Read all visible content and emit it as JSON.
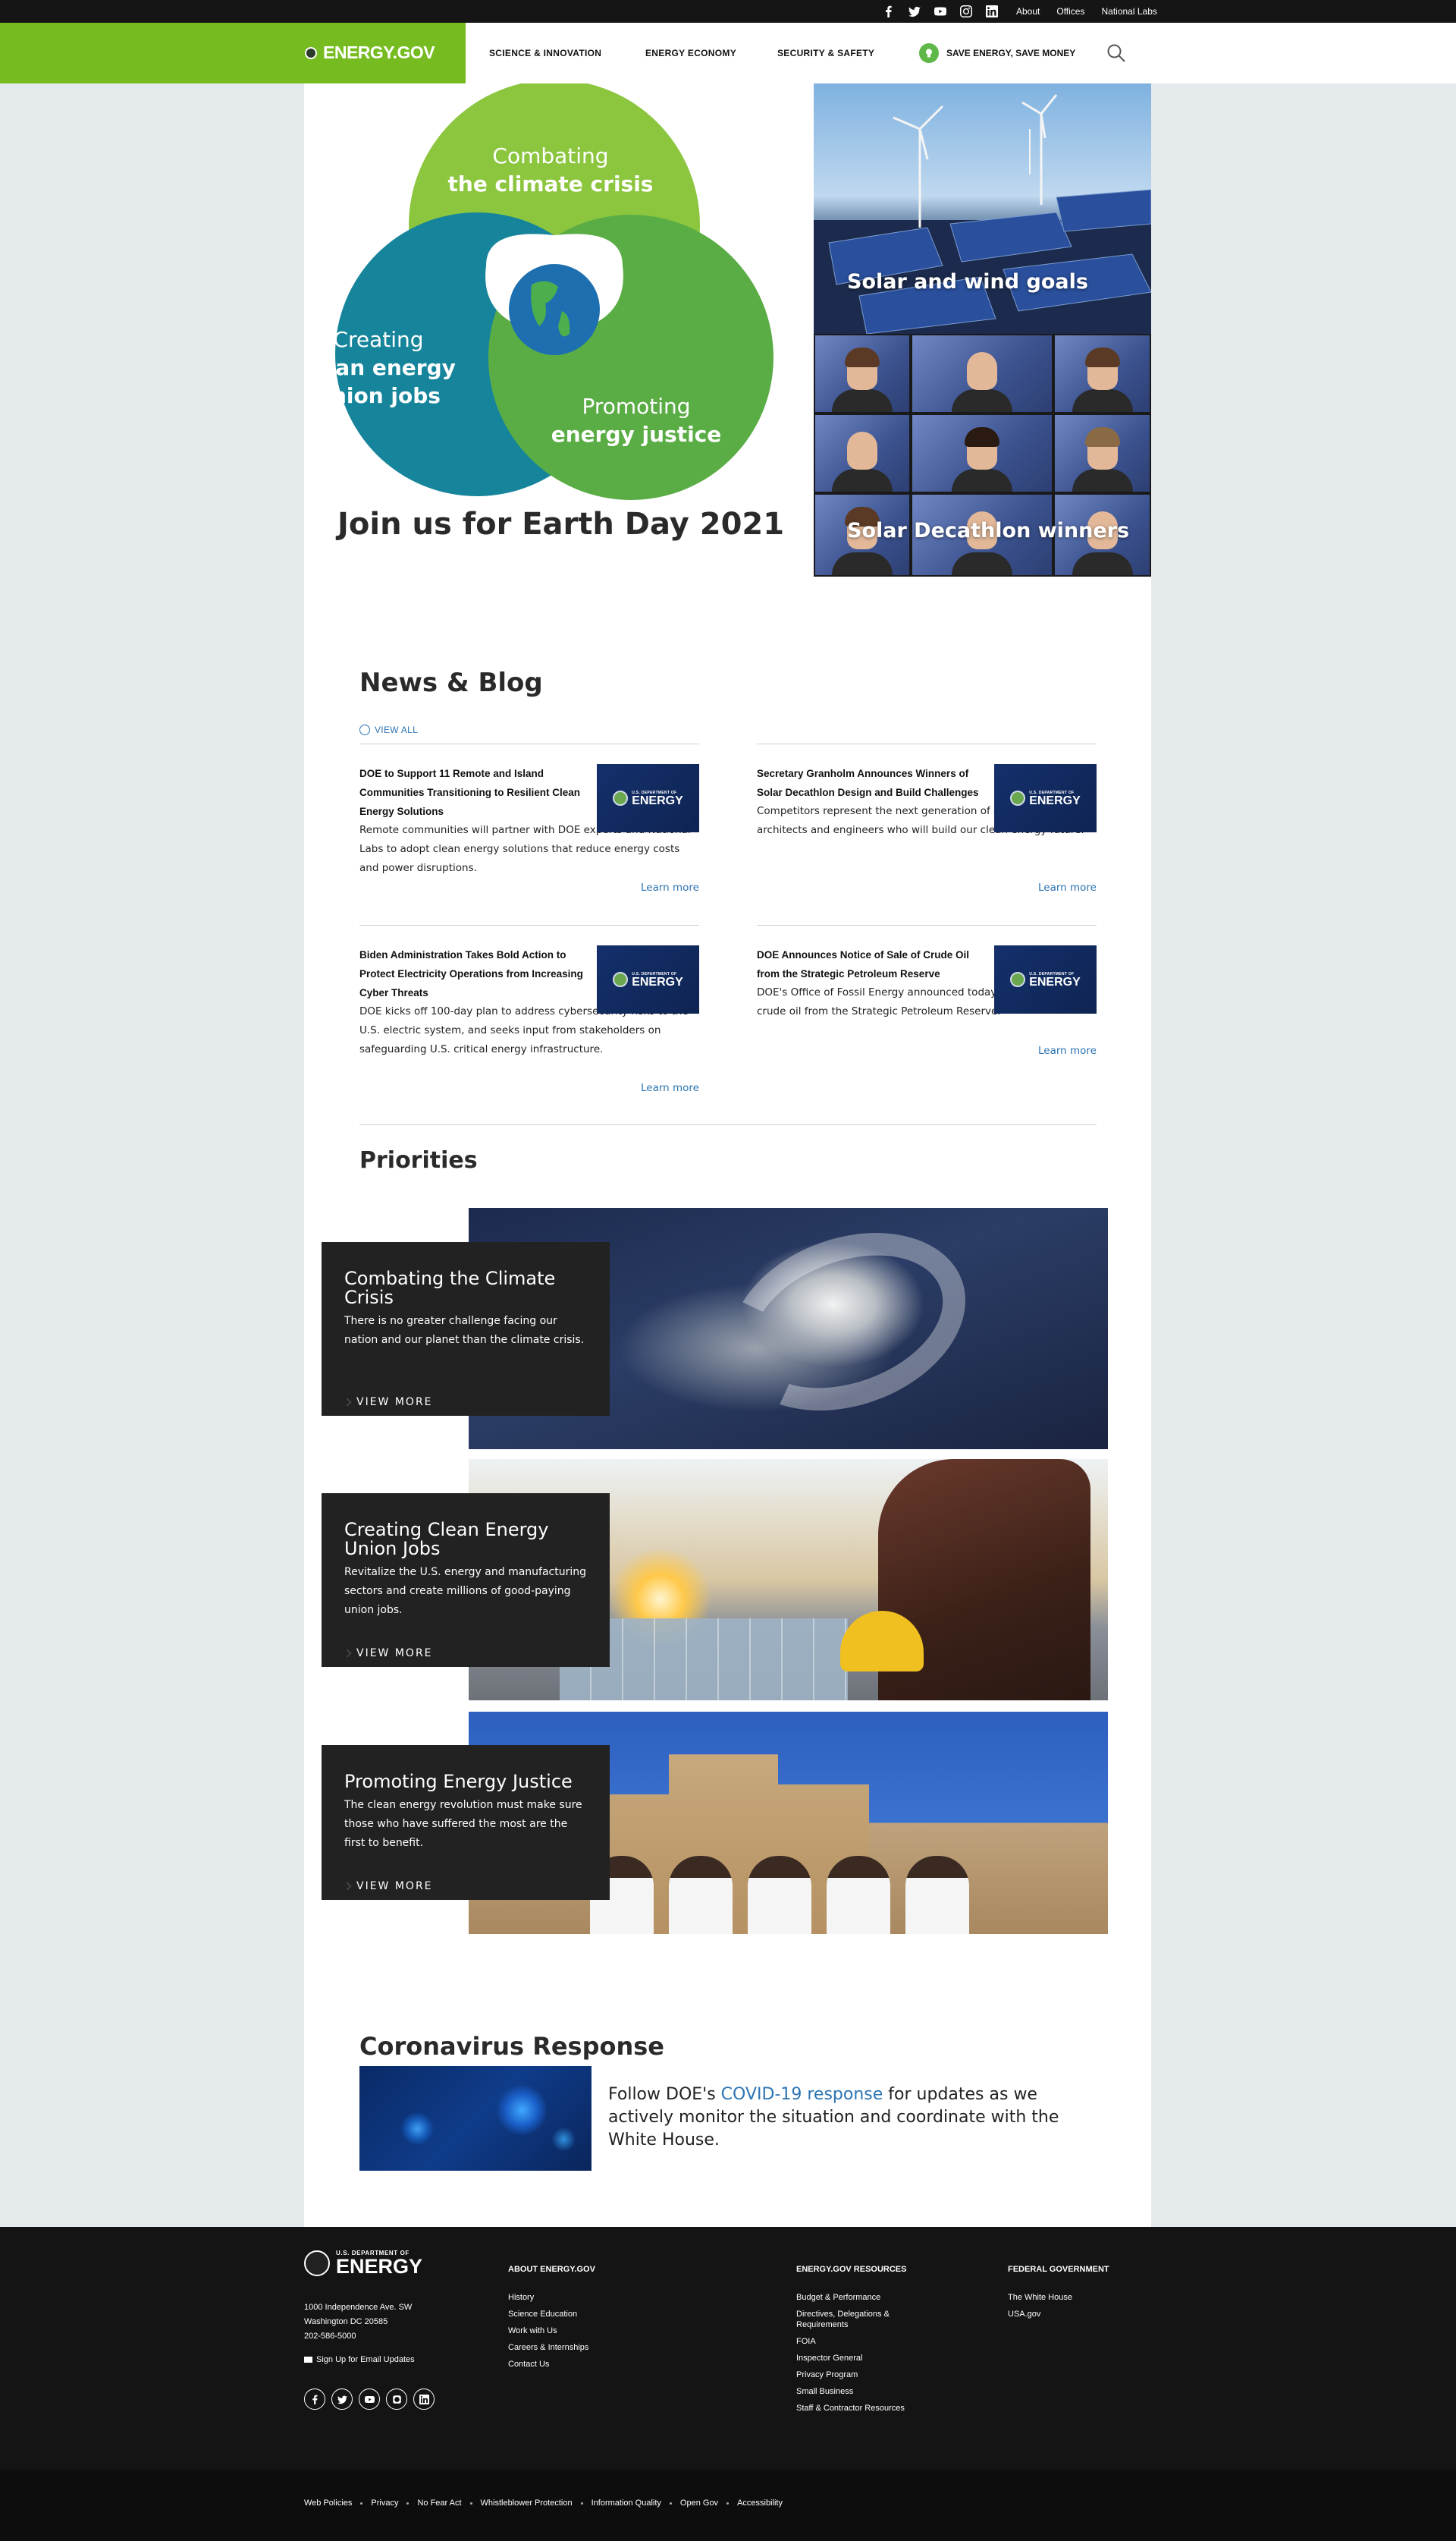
{
  "topbar": {
    "social_icons": [
      "facebook-icon",
      "twitter-icon",
      "youtube-icon",
      "instagram-icon",
      "linkedin-icon"
    ],
    "links": [
      "About",
      "Offices",
      "National Labs"
    ]
  },
  "nav": {
    "logo": "ENERGY.GOV",
    "menu": [
      "SCIENCE & INNOVATION",
      "ENERGY ECONOMY",
      "SECURITY & SAFETY"
    ],
    "save": "SAVE ENERGY, SAVE MONEY",
    "brand_green": "#76bc21"
  },
  "hero": {
    "circle_top": [
      "Combating",
      "the climate crisis"
    ],
    "circle_left": [
      "Creating",
      "clean energy",
      "union jobs"
    ],
    "circle_right": [
      "Promoting",
      "energy justice"
    ],
    "title": "Join us for Earth Day 2021",
    "tiles": [
      "Solar and wind goals",
      "Solar Decathlon winners"
    ],
    "colors": {
      "top": "#8cc63f",
      "left": "#16859b",
      "right": "#5aad45"
    }
  },
  "news": {
    "title": "News & Blog",
    "view_all": "VIEW ALL",
    "learn_more": "Learn more",
    "thumb_small": "U.S. DEPARTMENT OF",
    "thumb_big": "ENERGY",
    "articles": [
      {
        "title": "DOE to Support 11 Remote and Island Communities Transitioning to Resilient Clean Energy Solutions",
        "summary": "Remote communities will partner with DOE experts and National Labs to adopt clean energy solutions that reduce energy costs and power disruptions."
      },
      {
        "title": "Secretary Granholm Announces Winners of Solar Decathlon Design and Build Challenges",
        "summary": "Competitors represent the next generation of energy-savvy architects and engineers who will build our clean energy future."
      },
      {
        "title": "Biden Administration Takes Bold Action to Protect Electricity Operations from Increasing Cyber Threats",
        "summary": "DOE kicks off 100-day plan to address cybersecurity risks to the U.S. electric system, and seeks input from stakeholders on safeguarding U.S. critical energy infrastructure."
      },
      {
        "title": "DOE Announces Notice of Sale of Crude Oil from the Strategic Petroleum Reserve",
        "summary": "DOE's Office of Fossil Energy announced today a Notice of Sale of crude oil from the Strategic Petroleum Reserve."
      }
    ]
  },
  "priorities": {
    "title": "Priorities",
    "view_more": "VIEW MORE",
    "items": [
      {
        "title": "Combating the Climate Crisis",
        "text": "There is no greater challenge facing our nation and our planet than the climate crisis."
      },
      {
        "title": "Creating Clean Energy Union Jobs",
        "text": "Revitalize the U.S. energy and manufacturing sectors and create millions of good-paying union jobs."
      },
      {
        "title": "Promoting Energy Justice",
        "text": "The clean energy revolution must make sure those who have suffered the most are the first to benefit."
      }
    ]
  },
  "covid": {
    "title": "Coronavirus Response",
    "text_before": "Follow DOE's ",
    "link": "COVID-19 response",
    "text_after": " for updates as we actively monitor the situation and coordinate with the White House."
  },
  "footer": {
    "logo_small": "U.S. DEPARTMENT OF",
    "logo_big": "ENERGY",
    "address": [
      "1000 Independence Ave. SW",
      "Washington DC 20585",
      "202-586-5000"
    ],
    "signup": "Sign Up for Email Updates",
    "social_icons": [
      "facebook-icon",
      "twitter-icon",
      "youtube-icon",
      "instagram-icon",
      "linkedin-icon"
    ],
    "columns": [
      {
        "heading": "ABOUT ENERGY.GOV",
        "links": [
          "History",
          "Science Education",
          "Work with Us",
          "Careers & Internships",
          "Contact Us"
        ]
      },
      {
        "heading": "ENERGY.GOV RESOURCES",
        "links": [
          "Budget & Performance",
          "Directives, Delegations & Requirements",
          "FOIA",
          "Inspector General",
          "Privacy Program",
          "Small Business",
          "Staff & Contractor Resources"
        ]
      },
      {
        "heading": "FEDERAL GOVERNMENT",
        "links": [
          "The White House",
          "USA.gov"
        ]
      }
    ],
    "bottom_links": [
      "Web Policies",
      "Privacy",
      "No Fear Act",
      "Whistleblower Protection",
      "Information Quality",
      "Open Gov",
      "Accessibility"
    ]
  }
}
